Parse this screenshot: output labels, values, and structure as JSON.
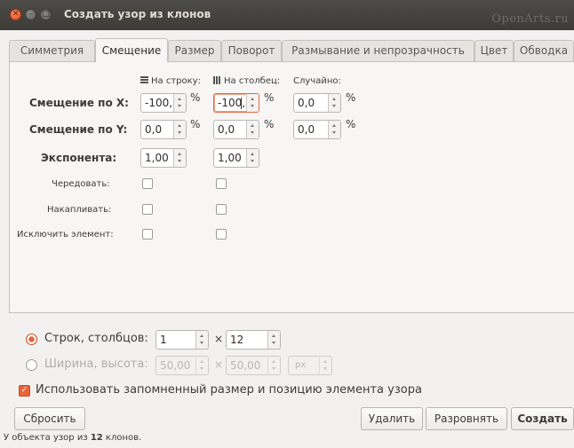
{
  "window": {
    "title": "Создать узор из клонов",
    "watermark": "OpenArts.ru"
  },
  "tabs": [
    {
      "label": "Симметрия",
      "active": false
    },
    {
      "label": "Смещение",
      "active": true
    },
    {
      "label": "Размер",
      "active": false
    },
    {
      "label": "Поворот",
      "active": false
    },
    {
      "label": "Размывание и непрозрачность",
      "active": false
    },
    {
      "label": "Цвет",
      "active": false
    },
    {
      "label": "Обводка",
      "active": false
    }
  ],
  "shift": {
    "headers": {
      "per_row": "На строку:",
      "per_column": "На столбец:",
      "random": "Случайно:"
    },
    "rows": {
      "shift_x": {
        "label": "Смещение по X:",
        "per_row": "-100,(",
        "per_column": "-100,(",
        "random": "0,0"
      },
      "shift_y": {
        "label": "Смещение по Y:",
        "per_row": "0,0",
        "per_column": "0,0",
        "random": "0,0"
      },
      "exponent": {
        "label": "Экспонента:",
        "per_row": "1,00",
        "per_column": "1,00"
      }
    },
    "percent": "%",
    "checks": {
      "alternate": {
        "label": "Чередовать:",
        "per_row": false,
        "per_column": false
      },
      "accumulate": {
        "label": "Накапливать:",
        "per_row": false,
        "per_column": false
      },
      "exclude": {
        "label": "Исключить элемент:",
        "per_row": false,
        "per_column": false
      }
    }
  },
  "layout": {
    "rows_cols": {
      "label": "Строк, столбцов:",
      "selected": true,
      "rows": "1",
      "cols": "12"
    },
    "width_height": {
      "label": "Ширина, высота:",
      "selected": false,
      "width": "50,00",
      "height": "50,00",
      "unit": "px"
    },
    "times": "×",
    "use_saved": {
      "label": "Использовать запомненный размер и позицию элемента узора",
      "checked": true
    }
  },
  "buttons": {
    "reset": "Сбросить",
    "delete": "Удалить",
    "unclump": "Разровнять",
    "create": "Создать"
  },
  "status": {
    "prefix": "У объекта узор из ",
    "count": "12",
    "suffix": " клонов."
  },
  "colors": {
    "accent": "#e8653a",
    "titlebar": "#3c3b37",
    "background": "#f2f1f0"
  }
}
